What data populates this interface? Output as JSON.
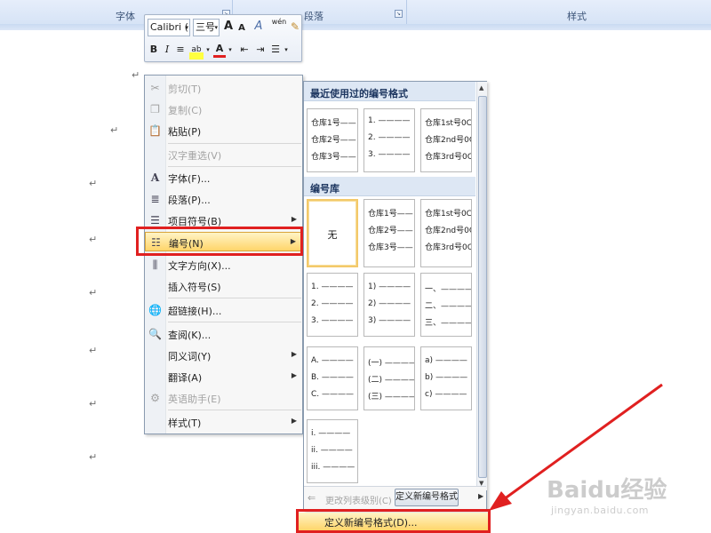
{
  "ribbon": {
    "groups": [
      {
        "label": "字体"
      },
      {
        "label": "段落"
      },
      {
        "label": "样式"
      }
    ]
  },
  "mini_toolbar": {
    "font_name": "Calibri (",
    "font_size": "三号",
    "grow_font": "A",
    "shrink_font": "A",
    "font_style_btn": "A",
    "phonetic_btn": "wén",
    "bold": "B",
    "italic": "I",
    "align_center": "≡",
    "highlight": "ab",
    "font_color": "A"
  },
  "context_menu": {
    "items": [
      {
        "label": "剪切(T)",
        "icon": "scissors-icon",
        "enabled": false
      },
      {
        "label": "复制(C)",
        "icon": "copy-icon",
        "enabled": false
      },
      {
        "label": "粘贴(P)",
        "icon": "paste-icon",
        "enabled": true
      },
      {
        "label": "汉字重选(V)",
        "icon": "",
        "enabled": false
      },
      {
        "label": "字体(F)...",
        "icon": "font-icon",
        "enabled": true
      },
      {
        "label": "段落(P)...",
        "icon": "paragraph-icon",
        "enabled": true
      },
      {
        "label": "项目符号(B)",
        "icon": "bullets-icon",
        "enabled": true,
        "submenu": true
      },
      {
        "label": "编号(N)",
        "icon": "numbering-icon",
        "enabled": true,
        "submenu": true,
        "highlighted": true
      },
      {
        "label": "文字方向(X)...",
        "icon": "text-direction-icon",
        "enabled": true
      },
      {
        "label": "插入符号(S)",
        "icon": "",
        "enabled": true
      },
      {
        "label": "超链接(H)...",
        "icon": "hyperlink-icon",
        "enabled": true
      },
      {
        "label": "查阅(K)...",
        "icon": "research-icon",
        "enabled": true
      },
      {
        "label": "同义词(Y)",
        "icon": "",
        "enabled": true,
        "submenu": true
      },
      {
        "label": "翻译(A)",
        "icon": "",
        "enabled": true,
        "submenu": true
      },
      {
        "label": "英语助手(E)",
        "icon": "english-assistant-icon",
        "enabled": false
      },
      {
        "label": "样式(T)",
        "icon": "",
        "enabled": true,
        "submenu": true
      }
    ]
  },
  "gallery": {
    "recent_header": "最近使用过的编号格式",
    "library_header": "编号库",
    "none_label": "无",
    "recent": [
      [
        "仓库1号——",
        "仓库2号——",
        "仓库3号——"
      ],
      [
        "1. ————",
        "2. ————",
        "3. ————"
      ],
      [
        "仓库1st号0C",
        "仓库2nd号0C",
        "仓库3rd号0C"
      ]
    ],
    "library": [
      [
        "仓库1号——",
        "仓库2号——",
        "仓库3号——"
      ],
      [
        "仓库1st号0C",
        "仓库2nd号0C",
        "仓库3rd号0C"
      ],
      [
        "1. ————",
        "2. ————",
        "3. ————"
      ],
      [
        "1) ————",
        "2) ————",
        "3) ————"
      ],
      [
        "一、————",
        "二、————",
        "三、————"
      ],
      [
        "A. ————",
        "B. ————",
        "C. ————"
      ],
      [
        "(一) ————",
        "(二) ————",
        "(三) ————"
      ],
      [
        "a) ————",
        "b) ————",
        "c) ————"
      ],
      [
        "i. ————",
        "ii. ————",
        "iii. ————"
      ]
    ],
    "change_level": "更改列表级别(C)",
    "define_button": "定义新编号格式",
    "define_item": "定义新编号格式(D)..."
  },
  "watermark": {
    "brand": "Baidu经验",
    "url": "jingyan.baidu.com"
  },
  "colors": {
    "annotation": "#e02020",
    "highlight": "#ffd56a"
  }
}
